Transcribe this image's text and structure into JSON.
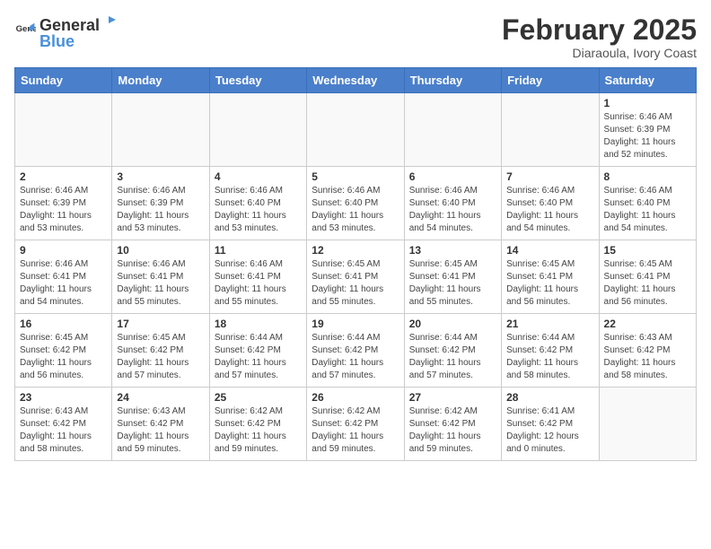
{
  "header": {
    "logo_general": "General",
    "logo_blue": "Blue",
    "month_title": "February 2025",
    "location": "Diaraoula, Ivory Coast"
  },
  "weekdays": [
    "Sunday",
    "Monday",
    "Tuesday",
    "Wednesday",
    "Thursday",
    "Friday",
    "Saturday"
  ],
  "weeks": [
    [
      {
        "day": "",
        "info": ""
      },
      {
        "day": "",
        "info": ""
      },
      {
        "day": "",
        "info": ""
      },
      {
        "day": "",
        "info": ""
      },
      {
        "day": "",
        "info": ""
      },
      {
        "day": "",
        "info": ""
      },
      {
        "day": "1",
        "info": "Sunrise: 6:46 AM\nSunset: 6:39 PM\nDaylight: 11 hours and 52 minutes."
      }
    ],
    [
      {
        "day": "2",
        "info": "Sunrise: 6:46 AM\nSunset: 6:39 PM\nDaylight: 11 hours and 53 minutes."
      },
      {
        "day": "3",
        "info": "Sunrise: 6:46 AM\nSunset: 6:39 PM\nDaylight: 11 hours and 53 minutes."
      },
      {
        "day": "4",
        "info": "Sunrise: 6:46 AM\nSunset: 6:40 PM\nDaylight: 11 hours and 53 minutes."
      },
      {
        "day": "5",
        "info": "Sunrise: 6:46 AM\nSunset: 6:40 PM\nDaylight: 11 hours and 53 minutes."
      },
      {
        "day": "6",
        "info": "Sunrise: 6:46 AM\nSunset: 6:40 PM\nDaylight: 11 hours and 54 minutes."
      },
      {
        "day": "7",
        "info": "Sunrise: 6:46 AM\nSunset: 6:40 PM\nDaylight: 11 hours and 54 minutes."
      },
      {
        "day": "8",
        "info": "Sunrise: 6:46 AM\nSunset: 6:40 PM\nDaylight: 11 hours and 54 minutes."
      }
    ],
    [
      {
        "day": "9",
        "info": "Sunrise: 6:46 AM\nSunset: 6:41 PM\nDaylight: 11 hours and 54 minutes."
      },
      {
        "day": "10",
        "info": "Sunrise: 6:46 AM\nSunset: 6:41 PM\nDaylight: 11 hours and 55 minutes."
      },
      {
        "day": "11",
        "info": "Sunrise: 6:46 AM\nSunset: 6:41 PM\nDaylight: 11 hours and 55 minutes."
      },
      {
        "day": "12",
        "info": "Sunrise: 6:45 AM\nSunset: 6:41 PM\nDaylight: 11 hours and 55 minutes."
      },
      {
        "day": "13",
        "info": "Sunrise: 6:45 AM\nSunset: 6:41 PM\nDaylight: 11 hours and 55 minutes."
      },
      {
        "day": "14",
        "info": "Sunrise: 6:45 AM\nSunset: 6:41 PM\nDaylight: 11 hours and 56 minutes."
      },
      {
        "day": "15",
        "info": "Sunrise: 6:45 AM\nSunset: 6:41 PM\nDaylight: 11 hours and 56 minutes."
      }
    ],
    [
      {
        "day": "16",
        "info": "Sunrise: 6:45 AM\nSunset: 6:42 PM\nDaylight: 11 hours and 56 minutes."
      },
      {
        "day": "17",
        "info": "Sunrise: 6:45 AM\nSunset: 6:42 PM\nDaylight: 11 hours and 57 minutes."
      },
      {
        "day": "18",
        "info": "Sunrise: 6:44 AM\nSunset: 6:42 PM\nDaylight: 11 hours and 57 minutes."
      },
      {
        "day": "19",
        "info": "Sunrise: 6:44 AM\nSunset: 6:42 PM\nDaylight: 11 hours and 57 minutes."
      },
      {
        "day": "20",
        "info": "Sunrise: 6:44 AM\nSunset: 6:42 PM\nDaylight: 11 hours and 57 minutes."
      },
      {
        "day": "21",
        "info": "Sunrise: 6:44 AM\nSunset: 6:42 PM\nDaylight: 11 hours and 58 minutes."
      },
      {
        "day": "22",
        "info": "Sunrise: 6:43 AM\nSunset: 6:42 PM\nDaylight: 11 hours and 58 minutes."
      }
    ],
    [
      {
        "day": "23",
        "info": "Sunrise: 6:43 AM\nSunset: 6:42 PM\nDaylight: 11 hours and 58 minutes."
      },
      {
        "day": "24",
        "info": "Sunrise: 6:43 AM\nSunset: 6:42 PM\nDaylight: 11 hours and 59 minutes."
      },
      {
        "day": "25",
        "info": "Sunrise: 6:42 AM\nSunset: 6:42 PM\nDaylight: 11 hours and 59 minutes."
      },
      {
        "day": "26",
        "info": "Sunrise: 6:42 AM\nSunset: 6:42 PM\nDaylight: 11 hours and 59 minutes."
      },
      {
        "day": "27",
        "info": "Sunrise: 6:42 AM\nSunset: 6:42 PM\nDaylight: 11 hours and 59 minutes."
      },
      {
        "day": "28",
        "info": "Sunrise: 6:41 AM\nSunset: 6:42 PM\nDaylight: 12 hours and 0 minutes."
      },
      {
        "day": "",
        "info": ""
      }
    ]
  ]
}
